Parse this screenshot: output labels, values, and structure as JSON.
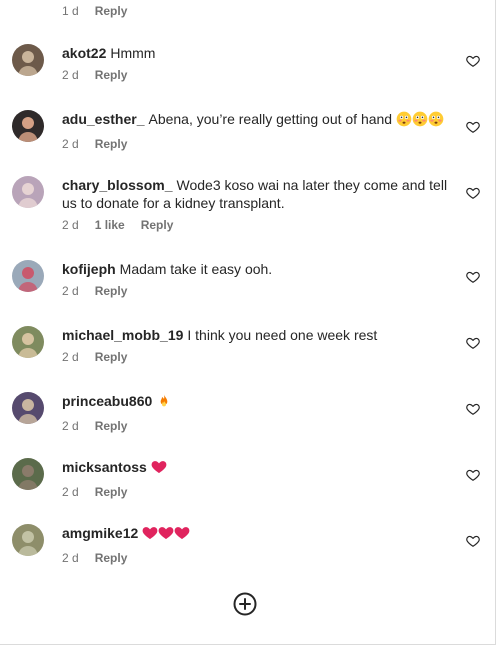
{
  "top_meta": {
    "time": "1 d",
    "reply": "Reply"
  },
  "comments": [
    {
      "username": "akot22",
      "text": "Hmmm",
      "time": "2 d",
      "likes": "",
      "reply": "Reply",
      "emojis": []
    },
    {
      "username": "adu_esther_",
      "text": "Abena, you’re really getting out of hand",
      "time": "2 d",
      "likes": "",
      "reply": "Reply",
      "emojis": [
        "flushed-face-emoji",
        "flushed-face-emoji",
        "flushed-face-emoji"
      ]
    },
    {
      "username": "chary_blossom_",
      "text": "Wode3 koso wai na later they come and tell us to donate for a kidney transplant.",
      "time": "2 d",
      "likes": "1 like",
      "reply": "Reply",
      "emojis": []
    },
    {
      "username": "kofijeph",
      "text": "Madam take it easy ooh.",
      "time": "2 d",
      "likes": "",
      "reply": "Reply",
      "emojis": []
    },
    {
      "username": "michael_mobb_19",
      "text": "I think you need one week rest",
      "time": "2 d",
      "likes": "",
      "reply": "Reply",
      "emojis": []
    },
    {
      "username": "princeabu860",
      "text": "",
      "time": "2 d",
      "likes": "",
      "reply": "Reply",
      "emojis": [
        "fire-emoji"
      ]
    },
    {
      "username": "micksantoss",
      "text": "",
      "time": "2 d",
      "likes": "",
      "reply": "Reply",
      "emojis": [
        "red-heart-emoji"
      ]
    },
    {
      "username": "amgmike12",
      "text": "",
      "time": "2 d",
      "likes": "",
      "reply": "Reply",
      "emojis": [
        "red-heart-emoji",
        "red-heart-emoji",
        "red-heart-emoji"
      ]
    }
  ],
  "icons": {
    "like": "heart-outline-icon",
    "load_more": "plus-circle-icon"
  },
  "colors": {
    "text": "#262626",
    "secondary": "#737373",
    "heart": "#e0245e",
    "fire": "#f57c00",
    "border": "#dbdbdb"
  }
}
